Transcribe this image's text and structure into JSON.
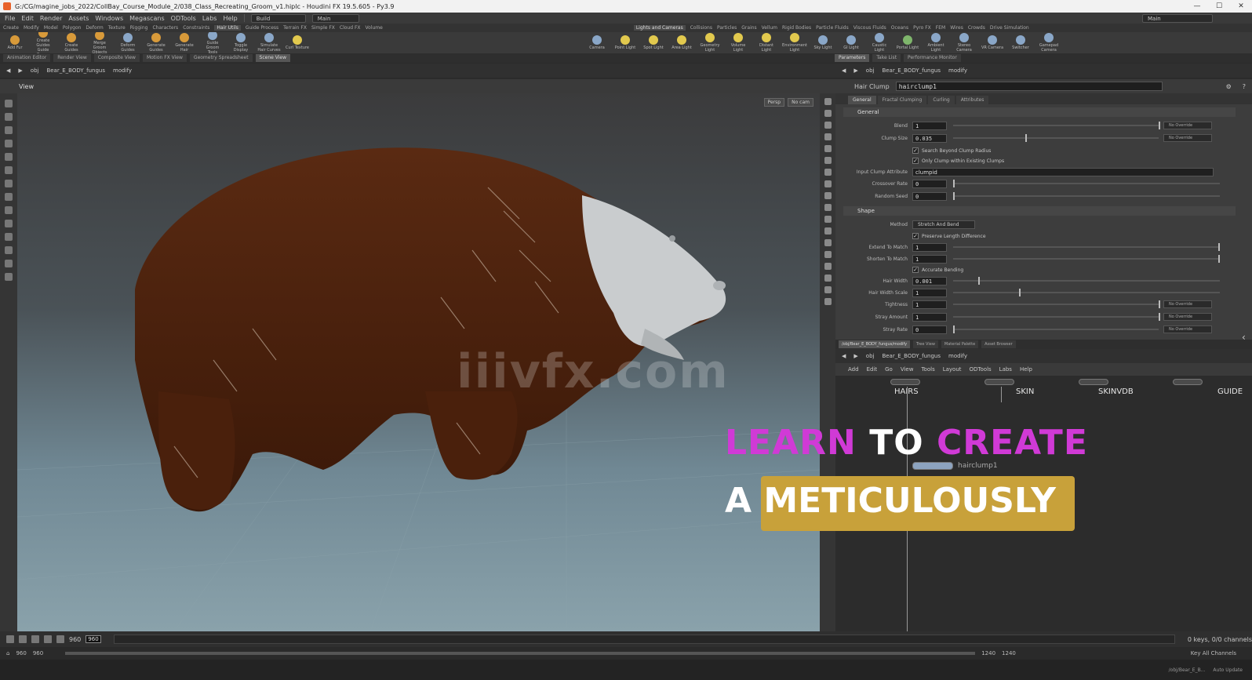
{
  "titlebar": {
    "path": "G:/CG/magine_jobs_2022/CollBay_Course_Module_2/038_Class_Recreating_Groom_v1.hiplc - Houdini FX 19.5.605 - Py3.9",
    "controls": [
      "—",
      "☐",
      "✕"
    ]
  },
  "menu": {
    "items": [
      "File",
      "Edit",
      "Render",
      "Assets",
      "Windows",
      "Megascans",
      "ODTools",
      "Labs",
      "Help"
    ],
    "desktop": "Build",
    "context": "Main",
    "right_label": "Main"
  },
  "shelf_tabs_left": [
    "Create",
    "Modify",
    "Model",
    "Polygon",
    "Deform",
    "Texture",
    "Rigging",
    "Characters",
    "Constraints",
    "Hair Utils",
    "Guide Process",
    "Terrain FX",
    "Simple FX",
    "Cloud FX",
    "Volume"
  ],
  "shelf_tabs_left_active": "Hair Utils",
  "shelf_tabs_right": [
    "Lights and Cameras",
    "Collisions",
    "Particles",
    "Grains",
    "Vellum",
    "Rigid Bodies",
    "Particle Fluids",
    "Viscous Fluids",
    "Oceans",
    "Pyro FX",
    "FEM",
    "Wires",
    "Crowds",
    "Drive Simulation"
  ],
  "shelf_tabs_right_active": "Lights and Cameras",
  "shelf_tools_left": [
    {
      "label": "Add Fur",
      "color": "orange"
    },
    {
      "label": "Create Guides Guide Groom",
      "color": "orange"
    },
    {
      "label": "Create Guides",
      "color": "orange"
    },
    {
      "label": "Merge Groom Objects",
      "color": "orange"
    },
    {
      "label": "Deform Guides",
      "color": "blue"
    },
    {
      "label": "Generate Guides",
      "color": "orange"
    },
    {
      "label": "Generate Hair",
      "color": "orange"
    },
    {
      "label": "Guide Groom Tools",
      "color": "blue"
    },
    {
      "label": "Toggle Display",
      "color": "blue"
    },
    {
      "label": "Simulate Hair Curves",
      "color": "blue"
    },
    {
      "label": "Curl Texture",
      "color": "yellow"
    }
  ],
  "shelf_tools_right": [
    {
      "label": "Camera",
      "color": "blue"
    },
    {
      "label": "Point Light",
      "color": "yellow"
    },
    {
      "label": "Spot Light",
      "color": "yellow"
    },
    {
      "label": "Area Light",
      "color": "yellow"
    },
    {
      "label": "Geometry Light",
      "color": "yellow"
    },
    {
      "label": "Volume Light",
      "color": "yellow"
    },
    {
      "label": "Distant Light",
      "color": "yellow"
    },
    {
      "label": "Environment Light",
      "color": "yellow"
    },
    {
      "label": "Sky Light",
      "color": "blue"
    },
    {
      "label": "GI Light",
      "color": "blue"
    },
    {
      "label": "Caustic Light",
      "color": "blue"
    },
    {
      "label": "Portal Light",
      "color": "green"
    },
    {
      "label": "Ambient Light",
      "color": "blue"
    },
    {
      "label": "Stereo Camera",
      "color": "blue"
    },
    {
      "label": "VR Camera",
      "color": "blue"
    },
    {
      "label": "Switcher",
      "color": "blue"
    },
    {
      "label": "Gamepad Camera",
      "color": "blue"
    }
  ],
  "pane_tabs_left": [
    "Animation Editor",
    "Render View",
    "Composite View",
    "Motion FX View",
    "Geometry Spreadsheet",
    "Scene View"
  ],
  "pane_tabs_left_active": "Scene View",
  "pane_tabs_right": [
    "Parameters",
    "Take List",
    "Performance Monitor"
  ],
  "pane_tabs_right_active": "Parameters",
  "viewport": {
    "path": [
      "obj",
      "Bear_E_BODY_fungus",
      "modify"
    ],
    "title": "View",
    "buttons": [
      "Persp",
      "No cam"
    ],
    "watermark": "iiivfx.com"
  },
  "params": {
    "path": [
      "obj",
      "Bear_E_BODY_fungus",
      "modify"
    ],
    "node_type": "Hair Clump",
    "node_name": "hairclump1",
    "tabs": [
      "General",
      "Fractal Clumping",
      "Curling",
      "Attributes"
    ],
    "active_tab": "General",
    "section_general": "General",
    "section_shape": "Shape",
    "rows": [
      {
        "label": "Blend",
        "value": "1",
        "override": "No Override",
        "knob": 1.0
      },
      {
        "label": "Clump Size",
        "value": "0.035",
        "override": "No Override",
        "knob": 0.35
      }
    ],
    "check_search": "Search Beyond Clump Radius",
    "check_only": "Only Clump within Existing Clumps",
    "attr_label": "Input Clump Attribute",
    "attr_value": "clumpid",
    "crossover_label": "Crossover Rate",
    "crossover_value": "0",
    "seed_label": "Random Seed",
    "seed_value": "0",
    "method_label": "Method",
    "method_value": "Stretch And Bend",
    "check_preserve": "Preserve Length Difference",
    "extend_label": "Extend To Match",
    "extend_value": "1",
    "shorten_label": "Shorten To Match",
    "shorten_value": "1",
    "check_accurate": "Accurate Bending",
    "hairwidth_label": "Hair Width",
    "hairwidth_value": "0.001",
    "hairwidthscale_label": "Hair Width Scale",
    "hairwidthscale_value": "1",
    "tightness_label": "Tightness",
    "tightness_value": "1",
    "tightness_override": "No Override",
    "stray_label": "Stray Amount",
    "stray_value": "1",
    "stray_override": "No Override",
    "strayrate_label": "Stray Rate",
    "strayrate_value": "0",
    "strayrate_override": "No Override"
  },
  "network": {
    "tabs": [
      "/obj/Bear_E_BODY_fungus/modify",
      "Tree View",
      "Material Palette",
      "Asset Browser"
    ],
    "active_tab": "/obj/Bear_E_BODY_fungus/modify",
    "path": [
      "obj",
      "Bear_E_BODY_fungus",
      "modify"
    ],
    "menu": [
      "Add",
      "Edit",
      "Go",
      "View",
      "Tools",
      "Layout",
      "ODTools",
      "Labs",
      "Help"
    ],
    "nodes": [
      "HAIRS",
      "SKIN",
      "SKINVDB",
      "GUIDE"
    ],
    "current_node": "hairclump1"
  },
  "promo": {
    "line1_a": "LEARN",
    "line1_b": "TO",
    "line1_c": "CREATE",
    "line2": "A METICULOUSLY"
  },
  "timeline": {
    "current_frame": "960",
    "start": "960",
    "end": "960",
    "range_start": "960",
    "range_end": "1240",
    "range_end2": "1240",
    "fps_info": "0 keys, 0/0 channels",
    "key_label": "Key All Channels"
  },
  "status": {
    "path": "/obj/Bear_E_B...",
    "update": "Auto Update"
  }
}
